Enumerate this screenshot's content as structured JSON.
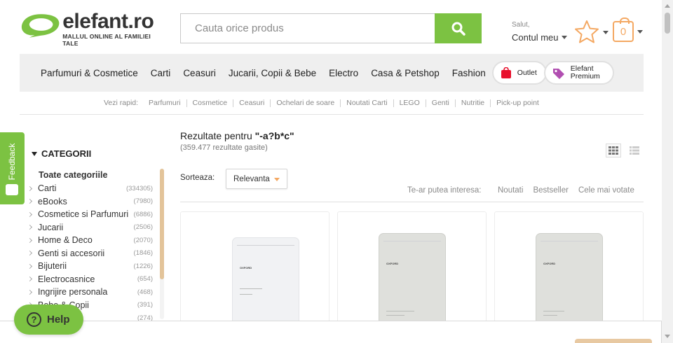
{
  "header": {
    "logo_name": "elefant.ro",
    "logo_tagline": "MALLUL ONLINE AL FAMILIEI TALE",
    "search_placeholder": "Cauta orice produs",
    "account_greeting": "Salut,",
    "account_label": "Contul meu",
    "cart_count": "0"
  },
  "nav": {
    "items": [
      "Parfumuri & Cosmetice",
      "Carti",
      "Ceasuri",
      "Jucarii, Copii & Bebe",
      "Electro",
      "Casa & Petshop",
      "Fashion"
    ],
    "outlet_label": "Outlet",
    "premium_label_1": "Elefant",
    "premium_label_2": "Premium"
  },
  "quick": {
    "label": "Vezi rapid:",
    "items": [
      "Parfumuri",
      "Cosmetice",
      "Ceasuri",
      "Ochelari de soare",
      "Noutati Carti",
      "LEGO",
      "Genti",
      "Nutritie",
      "Pick-up point"
    ]
  },
  "feedback_label": "Feedback",
  "sidebar": {
    "title": "CATEGORII",
    "all_label": "Toate categoriile",
    "categories": [
      {
        "name": "Carti",
        "count": "(334305)"
      },
      {
        "name": "eBooks",
        "count": "(7980)"
      },
      {
        "name": "Cosmetice si Parfumuri",
        "count": "(6886)"
      },
      {
        "name": "Jucarii",
        "count": "(2506)"
      },
      {
        "name": "Home & Deco",
        "count": "(2070)"
      },
      {
        "name": "Genti si accesorii",
        "count": "(1846)"
      },
      {
        "name": "Bijuterii",
        "count": "(1226)"
      },
      {
        "name": "Electrocasnice",
        "count": "(654)"
      },
      {
        "name": "Ingrijire personala",
        "count": "(468)"
      },
      {
        "name": "Bebe & Copii",
        "count": "(391)"
      },
      {
        "name": "",
        "count": "(274)"
      }
    ]
  },
  "results": {
    "title_prefix": "Rezultate pentru ",
    "query": "\"-a?b*c\"",
    "count_text": "(359.477 rezultate gasite)",
    "sort_label": "Sorteaza:",
    "sort_value": "Relevanta",
    "interest_label": "Te-ar putea interesa:",
    "interest_links": [
      "Noutati",
      "Bestseller",
      "Cele mai votate"
    ]
  },
  "products": [
    {
      "brand": "OXFORD"
    },
    {
      "brand": "OXFORD"
    },
    {
      "brand": "OXFORD"
    }
  ],
  "help_label": "Help",
  "colors": {
    "accent_green": "#7cc242",
    "accent_orange": "#f4a862",
    "outlet_red": "#e8112d",
    "premium_purple": "#b14fb1"
  }
}
